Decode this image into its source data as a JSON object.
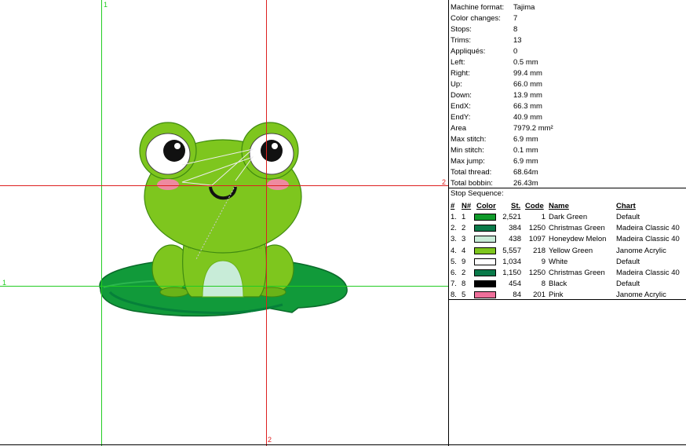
{
  "guides": {
    "v1_label": "1",
    "h1_label": "1",
    "h2_label": "2",
    "v2_label": "2"
  },
  "colors": {
    "green_guide": "#22cc22",
    "red_guide": "#dd2020"
  },
  "stats": [
    {
      "label": "Machine format:",
      "value": "Tajima"
    },
    {
      "label": "Color changes:",
      "value": "7"
    },
    {
      "label": "Stops:",
      "value": "8"
    },
    {
      "label": "Trims:",
      "value": "13"
    },
    {
      "label": "Appliqués:",
      "value": "0"
    },
    {
      "label": "Left:",
      "value": "0.5 mm"
    },
    {
      "label": "Right:",
      "value": "99.4 mm"
    },
    {
      "label": "Up:",
      "value": "66.0 mm"
    },
    {
      "label": "Down:",
      "value": "13.9 mm"
    },
    {
      "label": "EndX:",
      "value": "66.3 mm"
    },
    {
      "label": "EndY:",
      "value": "40.9 mm"
    },
    {
      "label": "Area",
      "value": "7979.2 mm²"
    },
    {
      "label": "Max stitch:",
      "value": "6.9 mm"
    },
    {
      "label": "Min stitch:",
      "value": "0.1 mm"
    },
    {
      "label": "Max jump:",
      "value": "6.9 mm"
    },
    {
      "label": "Total thread:",
      "value": "68.64m"
    },
    {
      "label": "Total bobbin:",
      "value": "26.43m"
    }
  ],
  "stop_sequence": {
    "title": "Stop Sequence:",
    "headers": {
      "idx": "#",
      "num": "N#",
      "color": "Color",
      "st": "St.",
      "code": "Code",
      "name": "Name",
      "chart": "Chart"
    },
    "rows": [
      {
        "idx": "1.",
        "num": "1",
        "swatch": "#109b2a",
        "st": "2,521",
        "code": "1",
        "name": "Dark Green",
        "chart": "Default"
      },
      {
        "idx": "2.",
        "num": "2",
        "swatch": "#0a7a4a",
        "st": "384",
        "code": "1250",
        "name": "Christmas Green",
        "chart": "Madeira Classic 40"
      },
      {
        "idx": "3.",
        "num": "3",
        "swatch": "#c8ecd8",
        "st": "438",
        "code": "1097",
        "name": "Honeydew Melon",
        "chart": "Madeira Classic 40"
      },
      {
        "idx": "4.",
        "num": "4",
        "swatch": "#7ec61e",
        "st": "5,557",
        "code": "218",
        "name": "Yellow Green",
        "chart": "Janome Acrylic"
      },
      {
        "idx": "5.",
        "num": "9",
        "swatch": "#ffffff",
        "st": "1,034",
        "code": "9",
        "name": "White",
        "chart": "Default"
      },
      {
        "idx": "6.",
        "num": "2",
        "swatch": "#0a7a4a",
        "st": "1,150",
        "code": "1250",
        "name": "Christmas Green",
        "chart": "Madeira Classic 40"
      },
      {
        "idx": "7.",
        "num": "8",
        "swatch": "#000000",
        "st": "454",
        "code": "8",
        "name": "Black",
        "chart": "Default"
      },
      {
        "idx": "8.",
        "num": "5",
        "swatch": "#ee6f9a",
        "st": "84",
        "code": "201",
        "name": "Pink",
        "chart": "Janome Acrylic"
      }
    ]
  }
}
